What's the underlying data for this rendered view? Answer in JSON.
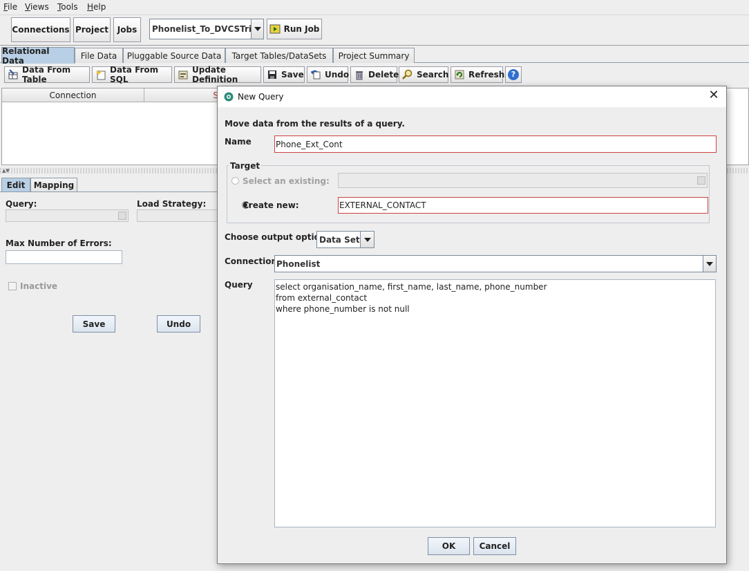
{
  "menu": {
    "items": [
      {
        "label": "File",
        "mnemonic": "F",
        "rest": "ile"
      },
      {
        "label": "Views",
        "mnemonic": "V",
        "rest": "iews"
      },
      {
        "label": "Tools",
        "mnemonic": "T",
        "rest": "ools"
      },
      {
        "label": "Help",
        "mnemonic": "H",
        "rest": "elp"
      }
    ]
  },
  "toolbar": {
    "connections_label": "Connections",
    "project_label": "Project",
    "jobs_label": "Jobs",
    "job_combo_value": "Phonelist_To_DVCSTrial",
    "run_job_label": "Run Job"
  },
  "tabs": {
    "relational": "Relational Data",
    "file": "File Data",
    "pluggable": "Pluggable Source Data",
    "target": "Target Tables/DataSets",
    "summary": "Project Summary"
  },
  "actions": {
    "data_from_table": "Data From Table",
    "data_from_sql": "Data From SQL",
    "update_definition": "Update Definition",
    "save": "Save",
    "undo": "Undo",
    "delete": "Delete",
    "search": "Search",
    "refresh": "Refresh",
    "help_glyph": "?"
  },
  "grid": {
    "col_connection": "Connection",
    "col_second": "S"
  },
  "edit_panel": {
    "tab_edit": "Edit",
    "tab_mapping": "Mapping",
    "query_label": "Query:",
    "load_strategy_label": "Load Strategy:",
    "max_errors_label": "Max Number of Errors:",
    "inactive_label": "Inactive",
    "save_button": "Save",
    "undo_button": "Undo"
  },
  "dialog": {
    "title": "New Query",
    "description": "Move data from the results of a query.",
    "name_label": "Name",
    "name_value": "Phone_Ext_Cont",
    "target_group_label": "Target",
    "select_existing_label": "Select an existing:",
    "create_new_label": "Create new:",
    "create_new_value": "EXTERNAL_CONTACT",
    "output_option_label": "Choose output option:",
    "output_option_value": "Data Set",
    "connection_label": "Connection:",
    "connection_value": "Phonelist",
    "query_label": "Query",
    "query_text": "select organisation_name, first_name, last_name, phone_number\nfrom external_contact\nwhere phone_number is not null",
    "ok_button": "OK",
    "cancel_button": "Cancel"
  },
  "colors": {
    "active_tab": "#b8cfe5",
    "error_border": "#d04040",
    "dialog_bg": "#eeeeee"
  }
}
